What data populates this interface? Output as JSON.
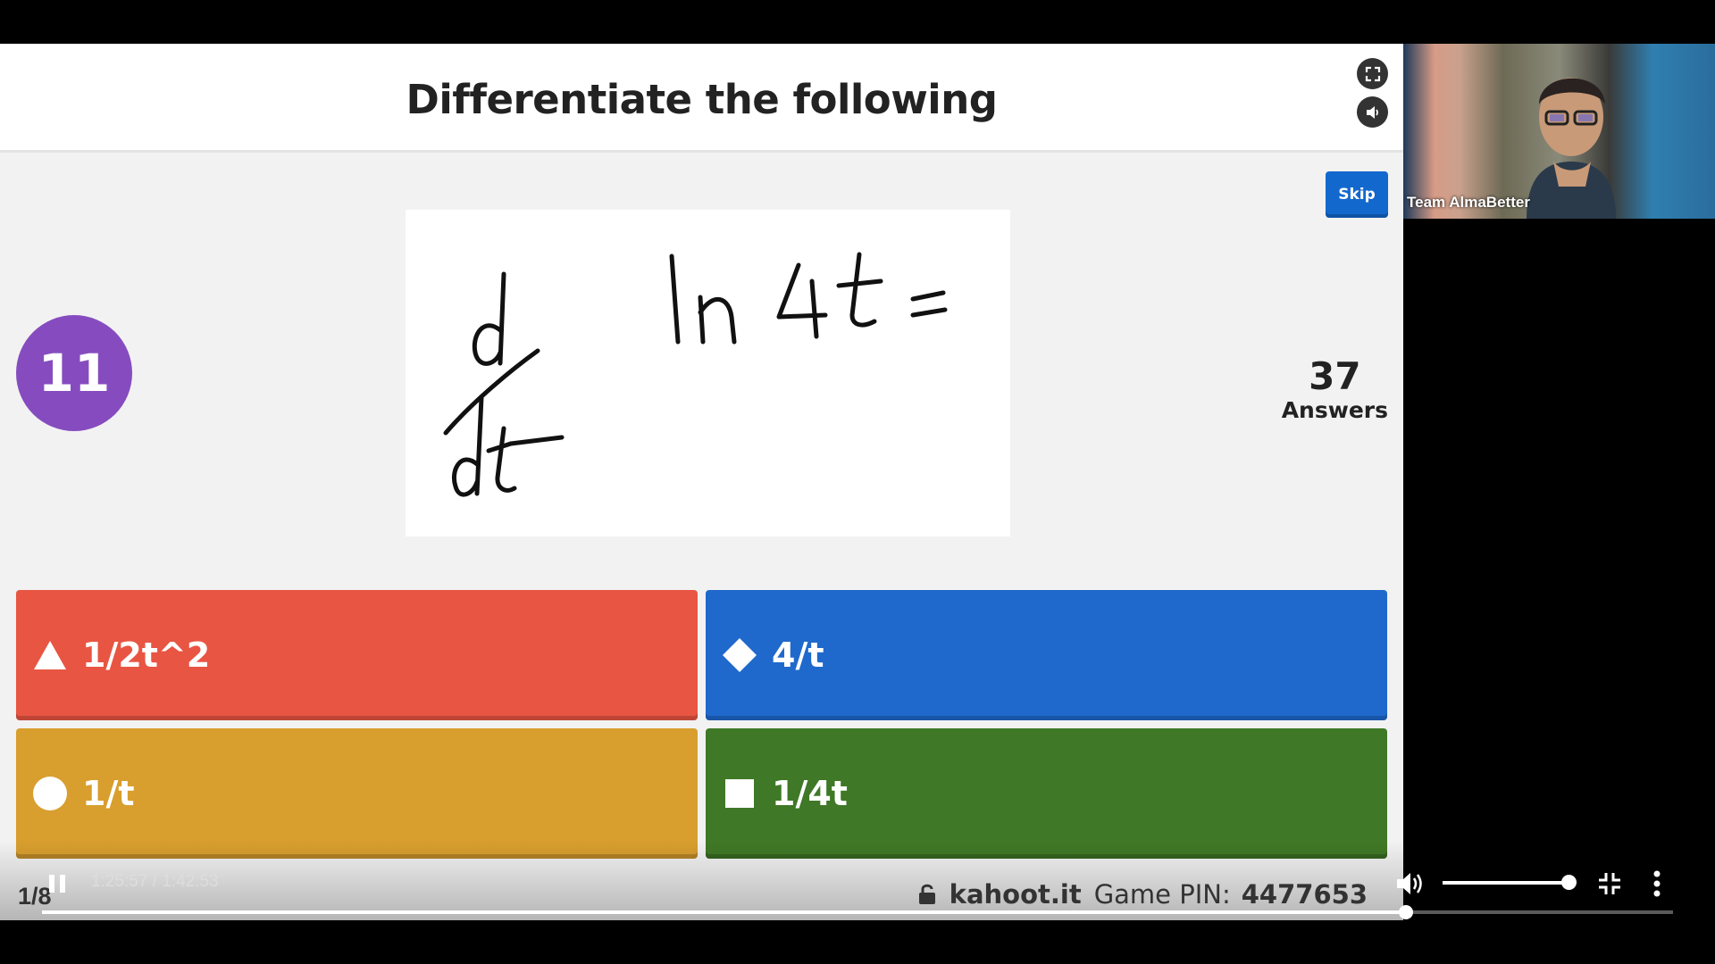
{
  "question": {
    "title": "Differentiate the following",
    "number": "11",
    "answers_count": "37",
    "answers_label": "Answers",
    "skip_label": "Skip"
  },
  "options": [
    {
      "shape": "triangle-icon",
      "text": "1/2t^2",
      "color": "#e85543"
    },
    {
      "shape": "diamond-icon",
      "text": "4/t",
      "color": "#1f69cc"
    },
    {
      "shape": "circle-icon",
      "text": "1/t",
      "color": "#d89e2e"
    },
    {
      "shape": "square-icon",
      "text": "1/4t",
      "color": "#3f7826"
    }
  ],
  "footer": {
    "pager": "1/8",
    "site": "kahoot.it",
    "pin_label": "Game PIN:",
    "pin": "4477653"
  },
  "webcam": {
    "label": "Team AlmaBetter"
  },
  "player": {
    "time": "1:25:57 / 1:42:53",
    "progress": 0.836,
    "volume": 1.0
  }
}
